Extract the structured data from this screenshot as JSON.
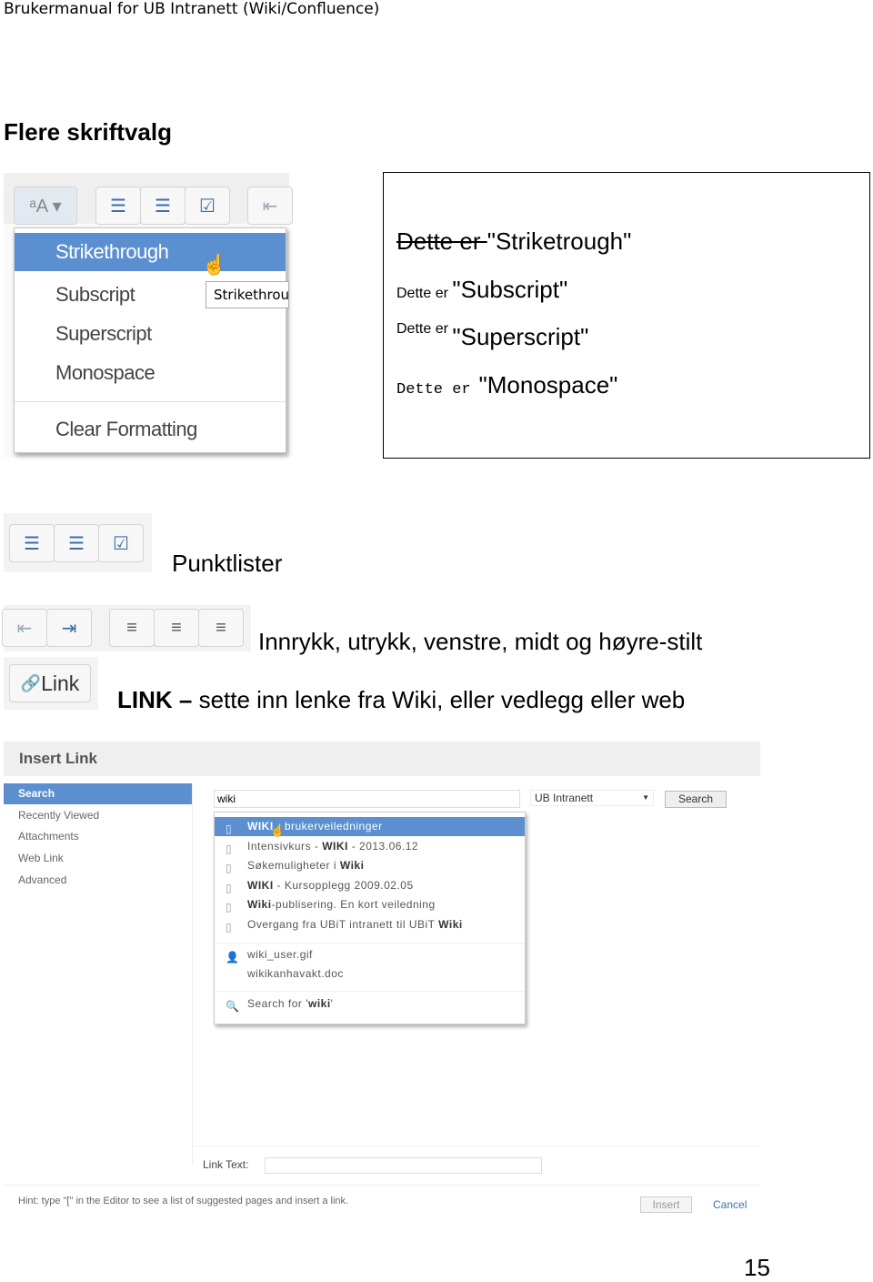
{
  "header": {
    "title": "Brukermanual for UB Intranett (Wiki/Confluence)"
  },
  "section_title": "Flere skriftvalg",
  "format_menu": {
    "items": [
      "Strikethrough",
      "Subscript",
      "Superscript",
      "Monospace",
      "Clear Formatting"
    ],
    "selected": "Strikethrough",
    "tooltip": "Strikethrou",
    "highlight_color": "#5b8fcf"
  },
  "examples": {
    "strike": {
      "prefix": "Dette er ",
      "label": "\"Striketrough\""
    },
    "sub": {
      "prefix": "Dette er",
      "label": "\"Subscript\""
    },
    "sup": {
      "prefix": "Dette er",
      "label": "\"Superscript\""
    },
    "mono": {
      "prefix": "Dette er",
      "label": "\"Monospace\""
    }
  },
  "captions": {
    "lists": "Punktlister",
    "indent": "Innrykk, utrykk, venstre, midt og høyre-stilt",
    "link_bold": "LINK –",
    "link_rest": " sette inn lenke fra Wiki, eller vedlegg eller web"
  },
  "link_button": "Link",
  "dialog": {
    "title": "Insert Link",
    "nav": [
      "Search",
      "Recently Viewed",
      "Attachments",
      "Web Link",
      "Advanced"
    ],
    "search_value": "wiki",
    "space_select": "UB Intranett",
    "search_button": "Search",
    "results": [
      {
        "bold": "WIKI",
        "rest": " - brukerveiledninger",
        "icon": "page-icon"
      },
      {
        "pre": "Intensivkurs - ",
        "bold": "WIKI",
        "rest": " - 2013.06.12",
        "icon": "page-icon"
      },
      {
        "pre": "Søkemuligheter i ",
        "bold": "Wiki",
        "rest": "",
        "icon": "page-icon"
      },
      {
        "bold": "WIKI",
        "rest": " - Kursopplegg 2009.02.05",
        "icon": "page-icon"
      },
      {
        "bold": "Wiki",
        "rest": "-publisering. En kort veiledning",
        "icon": "page-icon"
      },
      {
        "pre": "Overgang fra UBiT intranett til UBiT ",
        "bold": "Wiki",
        "rest": "",
        "icon": "page-icon"
      }
    ],
    "attachments": [
      "wiki_user.gif",
      "wikikanhavakt.doc"
    ],
    "search_for_pre": "Search for '",
    "search_for_bold": "wiki",
    "search_for_post": "'",
    "link_text_label": "Link Text:",
    "link_text_value": "",
    "hint": "Hint: type \"[\" in the Editor to see a list of suggested pages and insert a link.",
    "insert": "Insert",
    "cancel": "Cancel"
  },
  "page_number": "15"
}
